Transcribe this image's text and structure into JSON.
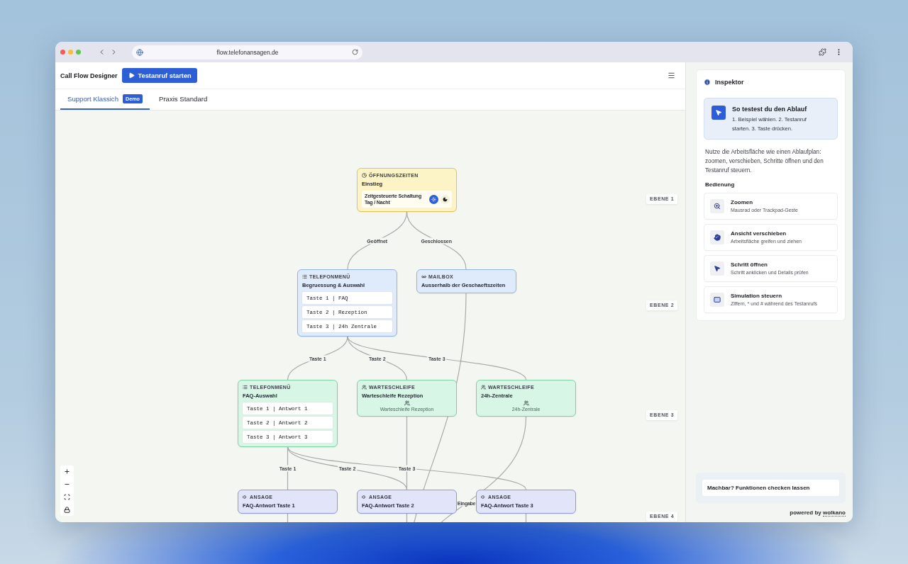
{
  "browser": {
    "url": "flow.telefonansagen.de"
  },
  "header": {
    "title": "Call Flow Designer",
    "test_call_button": "Testanruf starten"
  },
  "tabs": [
    {
      "label": "Support Klassich",
      "badge": "Demo",
      "selected": true
    },
    {
      "label": "Praxis Standard",
      "selected": false
    }
  ],
  "canvas": {
    "levels": [
      {
        "label": "EBENE 1",
        "nodes": [
          {
            "kind": "time_switch",
            "category": "ÖFFNUNGSZEITEN",
            "title": "Einstieg",
            "switch": {
              "label": "Zeitgesteuerte Schaltung",
              "sublabel": "Tag / Nacht",
              "modes": [
                {
                  "kind": "day",
                  "selected": true
                },
                {
                  "kind": "night",
                  "selected": false
                }
              ]
            }
          }
        ]
      },
      {
        "label": "EBENE 2",
        "nodes": [
          {
            "kind": "menu",
            "category": "TELEFONMENÜ",
            "title": "Begruessung & Auswahl",
            "options": [
              "Taste 1 | FAQ",
              "Taste 2 | Rezeption",
              "Taste 3 | 24h Zentrale"
            ]
          },
          {
            "kind": "mailbox",
            "category": "MAILBOX",
            "title": "Ausserhalb der Geschaeftszeiten"
          }
        ]
      },
      {
        "label": "EBENE 3",
        "nodes": [
          {
            "kind": "menu",
            "category": "TELEFONMENÜ",
            "title": "FAQ-Auswahl",
            "options": [
              "Taste 1 | Antwort 1",
              "Taste 2 | Antwort 2",
              "Taste 3 | Antwort 3"
            ]
          },
          {
            "kind": "queue",
            "category": "WARTESCHLEIFE",
            "title": "Warteschleife Rezeption",
            "caption": "Warteschleife Rezeption"
          },
          {
            "kind": "queue",
            "category": "WARTESCHLEIFE",
            "title": "24h-Zentrale",
            "caption": "24h-Zentrale"
          }
        ]
      },
      {
        "label": "EBENE 4",
        "nodes": [
          {
            "kind": "announcement",
            "category": "ANSAGE",
            "title": "FAQ-Antwort Taste 1"
          },
          {
            "kind": "announcement",
            "category": "ANSAGE",
            "title": "FAQ-Antwort Taste 2"
          },
          {
            "kind": "announcement",
            "category": "ANSAGE",
            "title": "FAQ-Antwort Taste 3"
          }
        ]
      }
    ],
    "edge_labels": [
      "Geöffnet",
      "Geschlossen",
      "Taste 1",
      "Taste 2",
      "Taste 3",
      "Taste 1",
      "Taste 2",
      "Taste 3",
      "Eingabe"
    ]
  },
  "inspector": {
    "title": "Inspektor",
    "guide": {
      "title": "So testest du den Ablauf",
      "text": "1. Beispiel wählen. 2. Testanruf starten. 3. Taste drücken."
    },
    "intro": "Nutze die Arbeitsfläche wie einen Ablaufplan: zoomen, verschieben, Schritte öffnen und den Testanruf steuern.",
    "controls_heading": "Bedienung",
    "controls": [
      {
        "kind": "zoom",
        "title": "Zoomen",
        "text": "Mausrad oder Trackpad-Geste"
      },
      {
        "kind": "pan",
        "title": "Ansicht verschieben",
        "text": "Arbeitsfläche greifen und ziehen"
      },
      {
        "kind": "open",
        "title": "Schritt öffnen",
        "text": "Schritt anklicken und Details prüfen"
      },
      {
        "kind": "simulate",
        "title": "Simulation steuern",
        "text": "Ziffern, * und # während des Testanrufs"
      }
    ],
    "feasibility_button": "Machbar? Funktionen checken lassen",
    "powered_by": {
      "text": "powered by",
      "link": "wolkano"
    }
  }
}
